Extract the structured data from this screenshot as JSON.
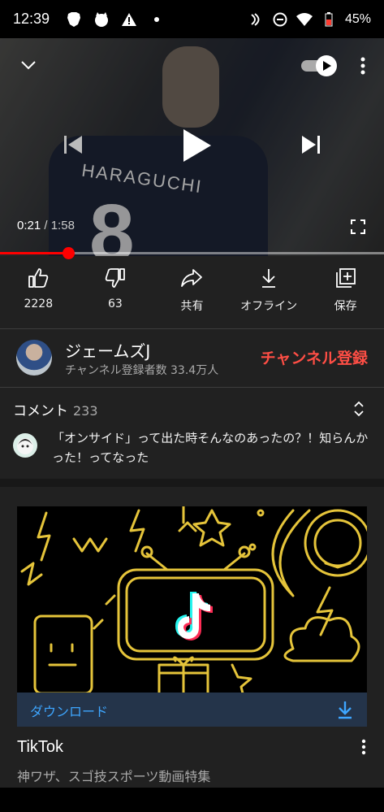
{
  "status_bar": {
    "time": "12:39",
    "battery": "45%"
  },
  "player": {
    "current_time": "0:21",
    "separator": " / ",
    "duration": "1:58",
    "progress_fraction": 0.178
  },
  "actions": {
    "like_count": "2228",
    "dislike_count": "63",
    "share_label": "共有",
    "offline_label": "オフライン",
    "save_label": "保存"
  },
  "channel": {
    "name": "ジェームズJ",
    "subscribers": "チャンネル登録者数 33.4万人",
    "subscribe_label": "チャンネル登録"
  },
  "comments": {
    "title": "コメント",
    "count": "233",
    "top_comment": "「オンサイド」って出た時そんなのあったの？！知らんかった！ってなった"
  },
  "ad": {
    "download_label": "ダウンロード",
    "title": "TikTok",
    "subtitle": "神ワザ、スゴ技スポーツ動画特集"
  },
  "colors": {
    "accent_red": "#ff0000",
    "subscribe_red": "#ff4e45",
    "link_blue": "#3ea6ff"
  }
}
